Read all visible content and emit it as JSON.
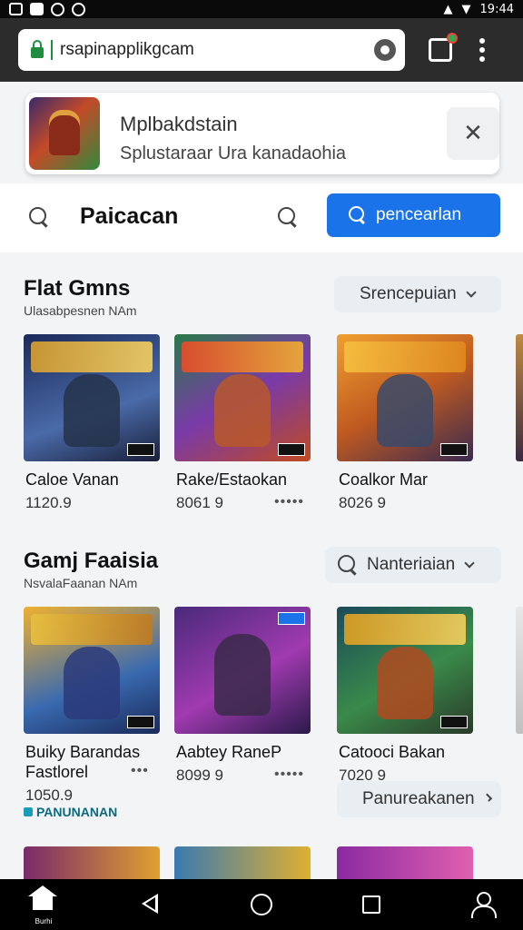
{
  "status": {
    "time": "19:44"
  },
  "browser": {
    "url": "rsapinapplikgcam"
  },
  "banner": {
    "title": "Mplbakdstain",
    "subtitle": "Splustaraar Ura kanadaohia",
    "close_glyph": "✕"
  },
  "search": {
    "label": "Paicacan",
    "button_label": "pencearlan"
  },
  "sections": [
    {
      "title": "Flat Gmns",
      "subtitle": "Ulasabpesnen NAm",
      "pill": "Srencepuian",
      "cards": [
        {
          "name": "Caloe Vanan",
          "size": "1120.9",
          "dots": ""
        },
        {
          "name": "Rake/Estaokan",
          "size": "8061 9",
          "dots": "•••••"
        },
        {
          "name": "Coalkor Mar",
          "size": "8026 9",
          "dots": ""
        }
      ]
    },
    {
      "title": "Gamj Faaisia",
      "subtitle": "NsvalaFaanan NAm",
      "pill": "Nanteriaian",
      "cards": [
        {
          "name": "Buiky Barandas",
          "name2": "Fastlorel",
          "size": "1050.9",
          "dots": "•••"
        },
        {
          "name": "Aabtey RaneP",
          "size": "8099 9",
          "dots": "•••••"
        },
        {
          "name": "Catooci Bakan",
          "size": "7020 9",
          "dots": ""
        }
      ],
      "featured": "PANUNANAN",
      "bottom_pill": "Panureakanen"
    }
  ],
  "nav": {
    "home_label": "Burhi"
  },
  "colors": {
    "accent": "#1a73e8",
    "bar": "#2c2c2c"
  }
}
